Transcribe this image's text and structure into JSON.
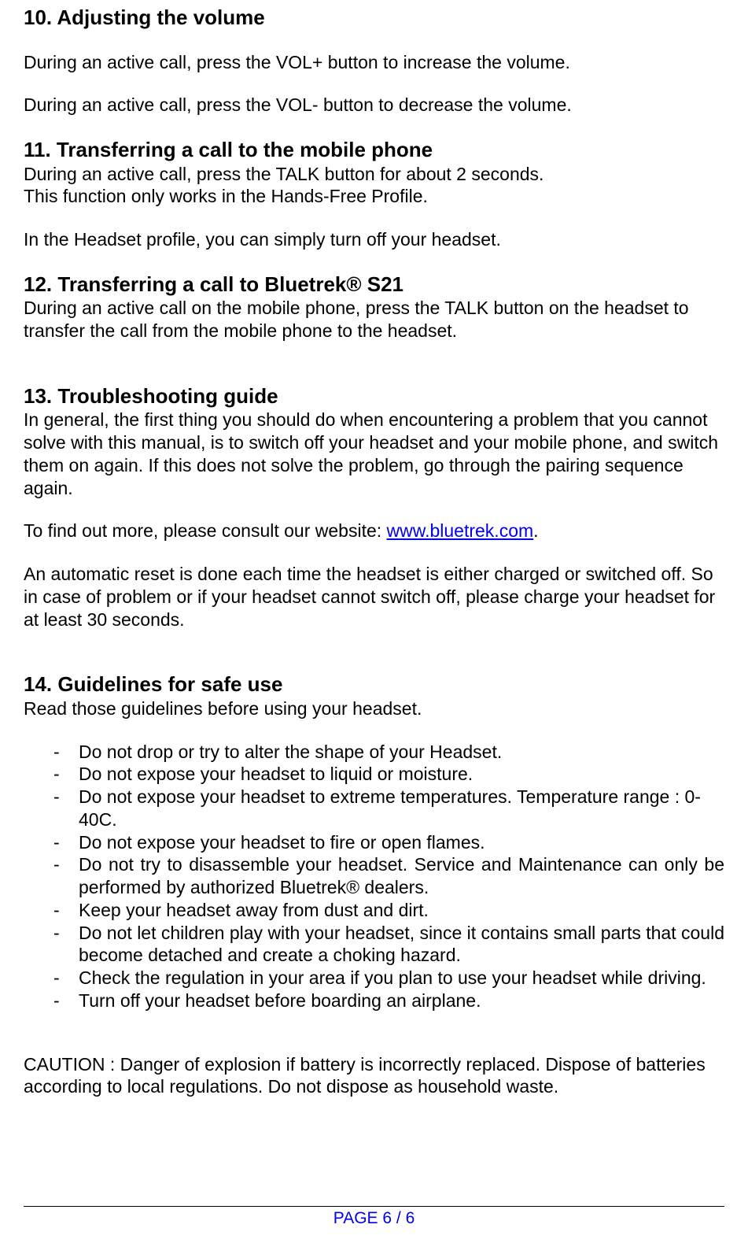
{
  "s10": {
    "heading": "10. Adjusting the volume",
    "p1": "During an active call, press the VOL+ button to increase the volume.",
    "p2": "During an active call, press the VOL- button to decrease the volume."
  },
  "s11": {
    "heading": "11. Transferring a call to the mobile phone",
    "p1": "During an active call, press the TALK button for about 2 seconds.",
    "p2": "This function only works in the Hands-Free Profile.",
    "p3": "In the Headset profile, you can simply turn off your headset."
  },
  "s12": {
    "heading": "12. Transferring a call to Bluetrek® S21",
    "p1": "During an active call on the mobile phone, press the TALK button on the headset to transfer the call from the mobile phone to the headset."
  },
  "s13": {
    "heading": "13. Troubleshooting guide",
    "p1": "In general, the first thing you should do when encountering a problem that you cannot solve with this manual, is to switch off your headset and your mobile phone, and switch them on again. If this does not solve the problem, go through the pairing sequence again.",
    "p2_prefix": "To find out more, please consult our website: ",
    "link": "www.bluetrek.com",
    "p2_suffix": ".",
    "p3": "An automatic reset is done each time the headset is either charged or switched off. So in case of problem or if your headset cannot switch off, please charge your headset for at least 30 seconds."
  },
  "s14": {
    "heading": "14. Guidelines for safe use",
    "p1": "Read those guidelines before using your headset.",
    "items": [
      "Do not drop or try to alter the shape of your Headset.",
      "Do not expose your headset to liquid or moisture.",
      "Do not expose your headset to extreme temperatures. Temperature range : 0-40C.",
      "Do not expose your headset to fire or open flames.",
      "Do not try to disassemble your headset. Service and Maintenance can only be performed by authorized Bluetrek® dealers.",
      "Keep your headset away from dust and dirt.",
      "Do not let children play with your headset, since it contains small parts that could become detached and create a choking hazard.",
      "Check the regulation in your area if you plan to use your headset while driving.",
      "Turn off your headset before boarding an airplane."
    ],
    "caution": "CAUTION : Danger of explosion if battery is incorrectly replaced. Dispose of batteries according to local regulations. Do not dispose as household waste."
  },
  "footer": "PAGE 6 / 6"
}
